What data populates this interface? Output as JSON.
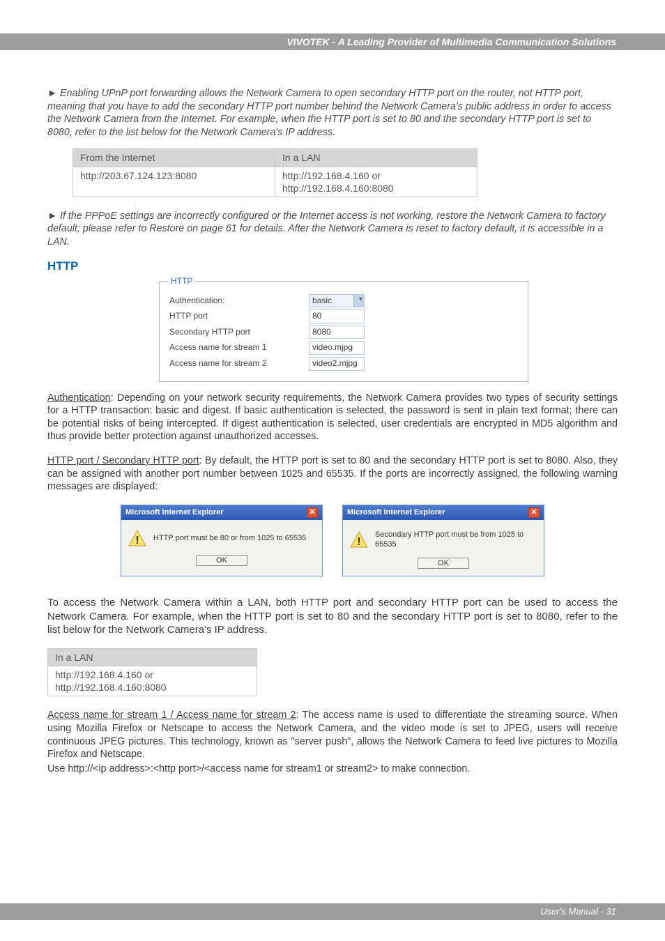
{
  "header": {
    "title": "VIVOTEK - A Leading Provider of Multimedia Communication Solutions"
  },
  "notes": {
    "upnp": "Enabling UPnP port forwarding allows the Network Camera to open secondary HTTP port on the router, not HTTP port, meaning that you have to add the secondary HTTP port number behind the Network Camera's public address in order to access the Network Camera from the Internet. For example, when the HTTP port is set to 80 and the secondary HTTP port is set to 8080, refer to the list below for the Network Camera's IP address.",
    "pppoe": "If the PPPoE settings are incorrectly configured or the Internet access is not working, restore the Network Camera to factory default; please refer to Restore on page 61 for details. After the Network Camera is reset to factory default, it is accessible in a LAN."
  },
  "addr_table": {
    "head_internet": "From the Internet",
    "head_lan": "In a LAN",
    "internet_val": "http://203.67.124.123:8080",
    "lan_val": "http://192.168.4.160 or\nhttp://192.168.4.160:8080"
  },
  "section": {
    "title": "HTTP"
  },
  "http_panel": {
    "legend": "HTTP",
    "auth_label": "Authentication:",
    "auth_val": "basic",
    "port_label": "HTTP port",
    "port_val": "80",
    "sec_port_label": "Secondary HTTP port",
    "sec_port_val": "8080",
    "stream1_label": "Access name for stream 1",
    "stream1_val": "video.mjpg",
    "stream2_label": "Access name for stream 2",
    "stream2_val": "video2.mjpg"
  },
  "para_auth_head": "Authentication",
  "para_auth": ": Depending on your network security requirements, the Network Camera provides two types of security settings for a HTTP transaction: basic and digest. If basic authentication is selected, the password is sent in plain text format; there can be potential risks of being intercepted. If digest authentication is selected, user credentials are encrypted in MD5 algorithm and thus provide better protection against unauthorized accesses.",
  "para_port_head": "HTTP port / Secondary HTTP port",
  "para_port": ": By default, the HTTP port is set to 80 and the secondary HTTP port is set to 8080. Also, they can be assigned with another port number between 1025 and 65535. If the ports are incorrectly assigned, the following warning messages are displayed:",
  "dlg": {
    "title": "Microsoft Internet Explorer",
    "msg1": "HTTP port must be 80 or from 1025 to 65535",
    "msg2": "Secondary HTTP port must be from 1025 to 65535",
    "ok": "OK"
  },
  "para_lan": "To access the Network Camera within a LAN, both HTTP port and secondary HTTP port can be used to access the Network Camera. For example, when the HTTP port is set to 80 and the secondary HTTP port is set to 8080, refer to the list below for the Network Camera's IP address.",
  "addr_table2": {
    "head": "In a LAN",
    "val": "http://192.168.4.160 or\nhttp://192.168.4.160:8080"
  },
  "para_access_head": "Access name for stream 1 / Access name for stream 2",
  "para_access": ": The access name is used to differentiate the streaming source. When using Mozilla Firefox or Netscape to access the Network Camera, and the video mode is set to JPEG, users will receive continuous JPEG pictures. This technology, known as \"server push\", allows the Network Camera to feed live pictures to Mozilla Firefox and Netscape.",
  "para_access2": "Use http://<ip address>:<http port>/<access name for stream1 or stream2> to make connection.",
  "footer": {
    "text": "User's Manual - 31"
  }
}
